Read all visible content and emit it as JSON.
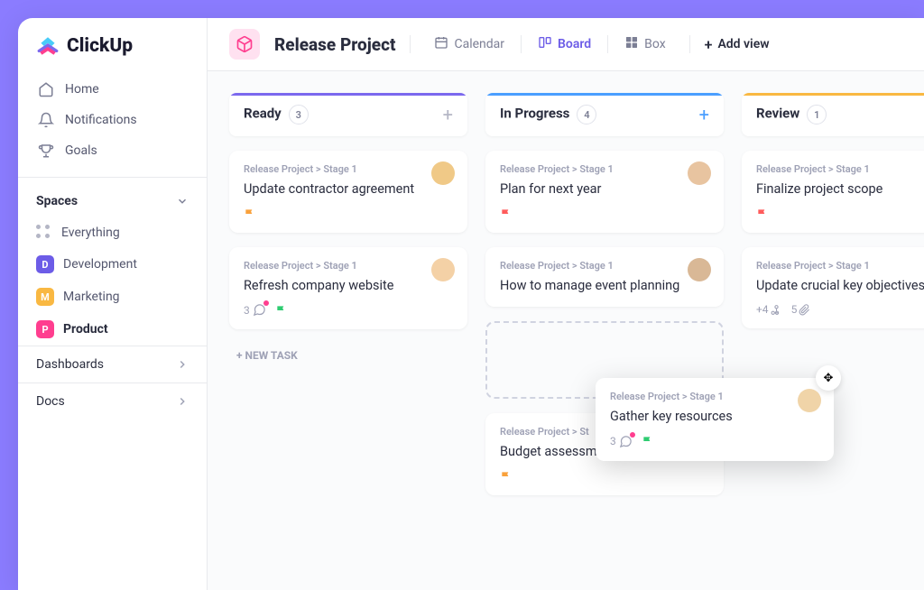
{
  "logo": "ClickUp",
  "nav": [
    {
      "icon": "home",
      "label": "Home"
    },
    {
      "icon": "bell",
      "label": "Notifications"
    },
    {
      "icon": "trophy",
      "label": "Goals"
    }
  ],
  "spaces_title": "Spaces",
  "everything_label": "Everything",
  "spaces": [
    {
      "badge": "D",
      "cls": "sb-d",
      "label": "Development",
      "active": false
    },
    {
      "badge": "M",
      "cls": "sb-m",
      "label": "Marketing",
      "active": false
    },
    {
      "badge": "P",
      "cls": "sb-p",
      "label": "Product",
      "active": true
    }
  ],
  "collapsibles": [
    "Dashboards",
    "Docs"
  ],
  "project_title": "Release Project",
  "views": [
    {
      "icon": "calendar",
      "label": "Calendar",
      "active": false
    },
    {
      "icon": "board",
      "label": "Board",
      "active": true
    },
    {
      "icon": "box",
      "label": "Box",
      "active": false
    }
  ],
  "add_view": "Add view",
  "columns": [
    {
      "name": "Ready",
      "count": "3",
      "cls": "col-ready",
      "add_blue": false,
      "cards": [
        {
          "bc": "Release Project > Stage 1",
          "title": "Update contractor agreement",
          "flag": "orange",
          "avatar": "#f0c987"
        },
        {
          "bc": "Release Project > Stage 1",
          "title": "Refresh company website",
          "avatar": "#f4d1a6",
          "comments": "3",
          "flag2": "green"
        }
      ],
      "new_task": "+ NEW TASK"
    },
    {
      "name": "In Progress",
      "count": "4",
      "cls": "col-progress",
      "add_blue": true,
      "cards": [
        {
          "bc": "Release Project > Stage 1",
          "title": "Plan for next year",
          "flag": "red",
          "avatar": "#e8c4a0"
        },
        {
          "bc": "Release Project > Stage 1",
          "title": "How to manage event planning",
          "avatar": "#d9b896"
        }
      ],
      "placeholder": true,
      "extra": {
        "bc": "Release Project > St",
        "title": "Budget assessment",
        "flag": "orange"
      }
    },
    {
      "name": "Review",
      "count": "1",
      "cls": "col-review",
      "add_blue": false,
      "cards": [
        {
          "bc": "Release Project > Stage 1",
          "title": "Finalize project scope",
          "flag": "red"
        },
        {
          "bc": "Release Project > Stage 1",
          "title": "Update crucial key objectives",
          "meta_subtasks": "+4",
          "meta_attach": "5"
        }
      ]
    }
  ],
  "floating": {
    "bc": "Release Project > Stage 1",
    "title": "Gather key resources",
    "comments": "3",
    "avatar": "#f0d4a8"
  }
}
